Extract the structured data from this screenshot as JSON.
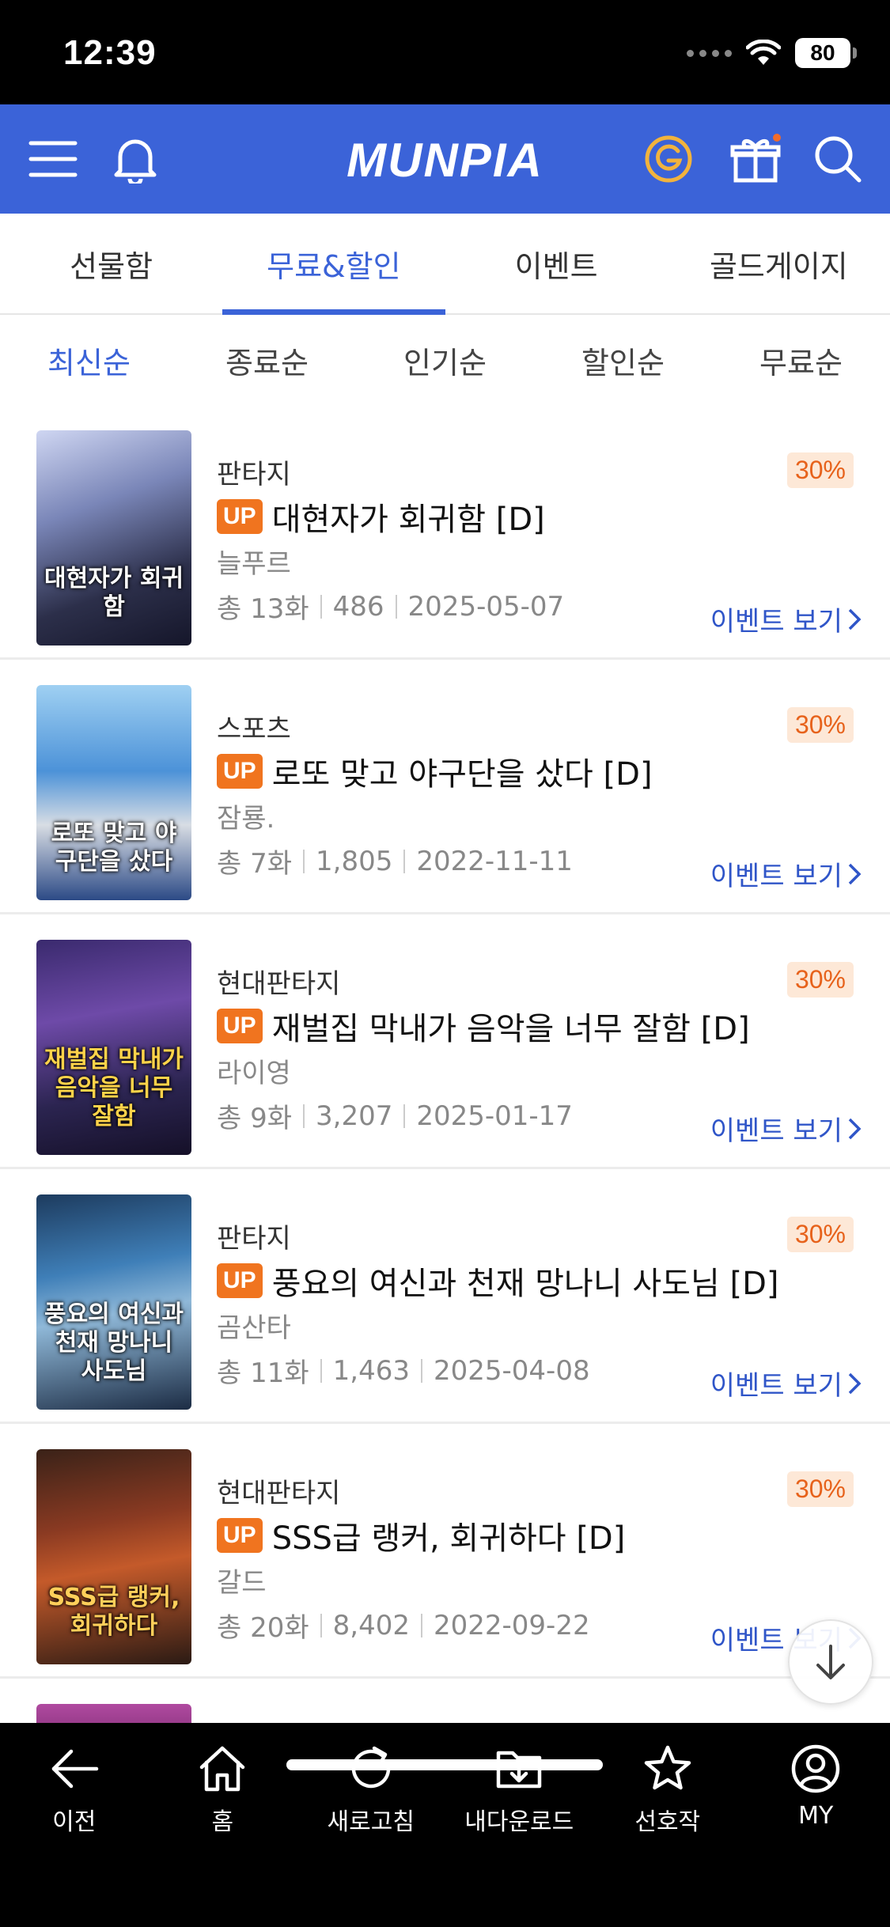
{
  "status_bar": {
    "time": "12:39",
    "battery": "80"
  },
  "header": {
    "logo": "MUNPIA",
    "accent_color": "#3b63d8"
  },
  "main_tabs": [
    {
      "label": "선물함",
      "active": false
    },
    {
      "label": "무료&할인",
      "active": true
    },
    {
      "label": "이벤트",
      "active": false
    },
    {
      "label": "골드게이지",
      "active": false
    }
  ],
  "sort_tabs": [
    {
      "label": "최신순",
      "active": true
    },
    {
      "label": "종료순",
      "active": false
    },
    {
      "label": "인기순",
      "active": false
    },
    {
      "label": "할인순",
      "active": false
    },
    {
      "label": "무료순",
      "active": false
    }
  ],
  "books": [
    {
      "genre": "판타지",
      "badge": "UP",
      "title": "대현자가 회귀함 [D]",
      "author": "늘푸르",
      "episodes": "총 13화",
      "views": "486",
      "date": "2025-05-07",
      "discount": "30%",
      "event_link": "이벤트 보기",
      "cover_text": "대현자가 회귀함"
    },
    {
      "genre": "스포츠",
      "badge": "UP",
      "title": "로또 맞고 야구단을 샀다 [D]",
      "author": "잠룡.",
      "episodes": "총 7화",
      "views": "1,805",
      "date": "2022-11-11",
      "discount": "30%",
      "event_link": "이벤트 보기",
      "cover_text": "로또 맞고 야구단을 샀다"
    },
    {
      "genre": "현대판타지",
      "badge": "UP",
      "title": "재벌집 막내가 음악을 너무 잘함 [D]",
      "author": "라이영",
      "episodes": "총 9화",
      "views": "3,207",
      "date": "2025-01-17",
      "discount": "30%",
      "event_link": "이벤트 보기",
      "cover_text": "재벌집 막내가 음악을 너무 잘함"
    },
    {
      "genre": "판타지",
      "badge": "UP",
      "title": "풍요의 여신과 천재 망나니 사도님 [D]",
      "author": "곰산타",
      "episodes": "총 11화",
      "views": "1,463",
      "date": "2025-04-08",
      "discount": "30%",
      "event_link": "이벤트 보기",
      "cover_text": "풍요의 여신과 천재 망나니 사도님"
    },
    {
      "genre": "현대판타지",
      "badge": "UP",
      "title": "SSS급 랭커, 회귀하다 [D]",
      "author": "갈드",
      "episodes": "총 20화",
      "views": "8,402",
      "date": "2022-09-22",
      "discount": "30%",
      "event_link": "이벤트 보기",
      "cover_text": "SSS급 랭커, 회귀하다"
    }
  ],
  "bottom_nav": [
    {
      "label": "이전",
      "icon": "back-arrow-icon"
    },
    {
      "label": "홈",
      "icon": "home-icon"
    },
    {
      "label": "새로고침",
      "icon": "refresh-icon"
    },
    {
      "label": "내다운로드",
      "icon": "download-folder-icon"
    },
    {
      "label": "선호작",
      "icon": "star-icon"
    },
    {
      "label": "MY",
      "icon": "user-icon"
    }
  ]
}
